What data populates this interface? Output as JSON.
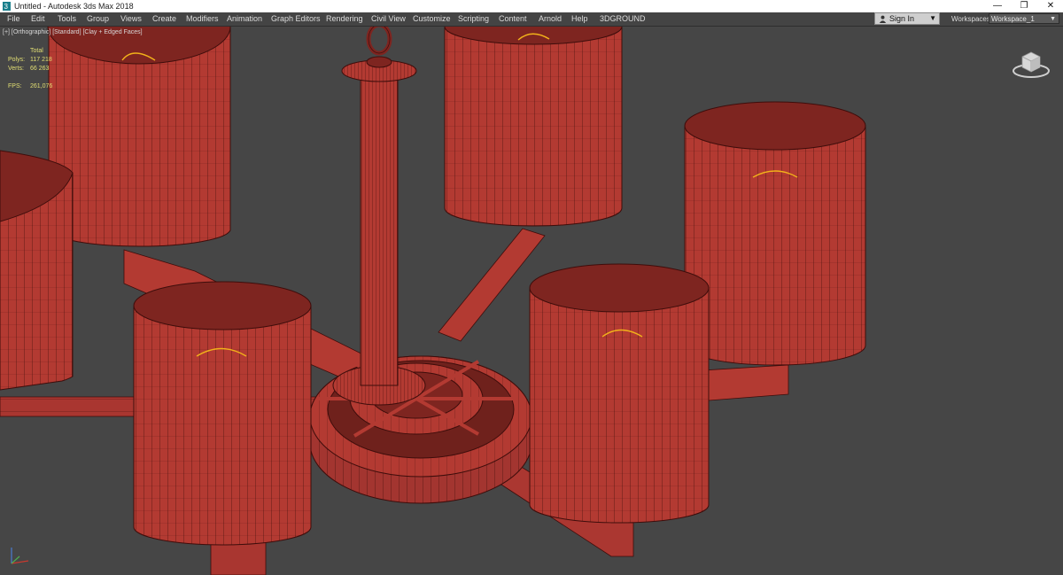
{
  "window": {
    "title": "Untitled - Autodesk 3ds Max 2018",
    "controls": [
      "—",
      "❐",
      "✕"
    ]
  },
  "menu": [
    "File",
    "Edit",
    "Tools",
    "Group",
    "Views",
    "Create",
    "Modifiers",
    "Animation",
    "Graph Editors",
    "Rendering",
    "Civil View",
    "Customize",
    "Scripting",
    "Content",
    "Arnold",
    "Help",
    "3DGROUND"
  ],
  "account": {
    "sign_in": "Sign In"
  },
  "workspace": {
    "label": "Workspaces:",
    "value": "Workspace_1"
  },
  "viewport": {
    "label": "[+] [Orthographic] [Standard] [Clay + Edged Faces]",
    "stats": {
      "total": "Total",
      "polys_label": "Polys:",
      "polys_value": "117 218",
      "verts_label": "Verts:",
      "verts_value": "66 263",
      "fps_label": "FPS:",
      "fps_value": "261,076"
    }
  },
  "icons": {
    "app": "3ds-max-logo-icon",
    "person": "person-icon",
    "dropdown": "chevron-down-icon",
    "viewcube": "viewcube-icon",
    "axis": "axis-tripod-icon"
  },
  "colors": {
    "model_fill": "#b33a32",
    "model_dark": "#7e2520",
    "wire": "#3e0d0b",
    "filament": "#f2b21a",
    "viewport_bg": "#464646",
    "menubar_bg": "#444444",
    "stats_text": "#e3df73"
  }
}
